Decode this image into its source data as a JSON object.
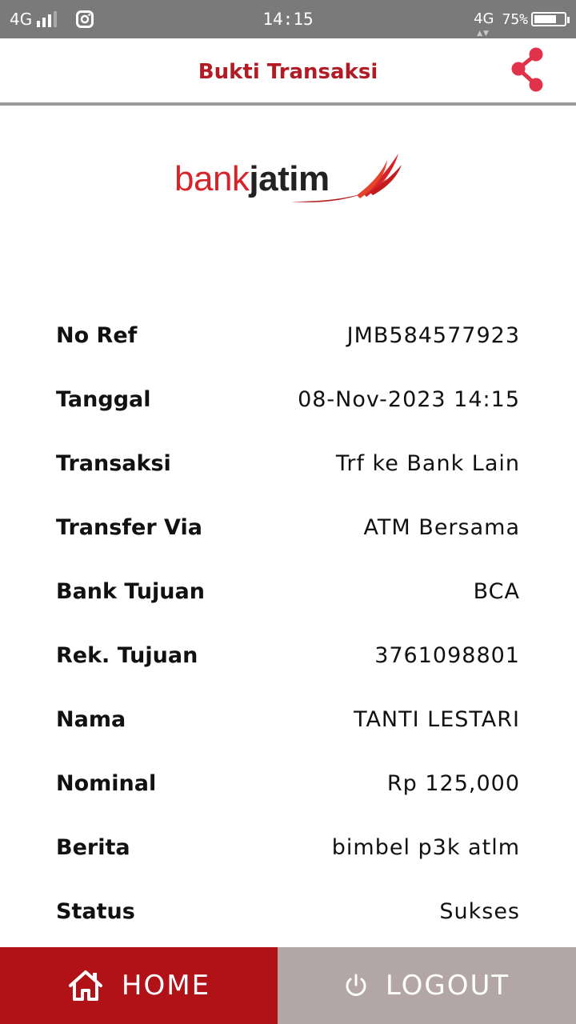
{
  "status_bar": {
    "network": "4G",
    "time": "14:15",
    "data_type": "4G",
    "battery_percent": "75%",
    "battery_level": 0.75
  },
  "header": {
    "title": "Bukti Transaksi",
    "share_icon": "share-icon",
    "accent_color": "#b21b24"
  },
  "logo": {
    "bank": "bank",
    "jatim": "jatim"
  },
  "details": [
    {
      "label": "No Ref",
      "value": "JMB584577923"
    },
    {
      "label": "Tanggal",
      "value": "08-Nov-2023 14:15"
    },
    {
      "label": "Transaksi",
      "value": "Trf ke Bank Lain"
    },
    {
      "label": "Transfer Via",
      "value": "ATM Bersama"
    },
    {
      "label": "Bank Tujuan",
      "value": "BCA"
    },
    {
      "label": "Rek. Tujuan",
      "value": "3761098801"
    },
    {
      "label": "Nama",
      "value": "TANTI LESTARI"
    },
    {
      "label": "Nominal",
      "value": "Rp 125,000"
    },
    {
      "label": "Berita",
      "value": "bimbel p3k atlm"
    },
    {
      "label": "Status",
      "value": "Sukses"
    }
  ],
  "bottom_bar": {
    "home_label": "HOME",
    "home_icon": "home-icon",
    "home_color": "#b01218",
    "logout_label": "LOGOUT",
    "logout_icon": "power-icon",
    "logout_color": "#b2a6a6"
  }
}
